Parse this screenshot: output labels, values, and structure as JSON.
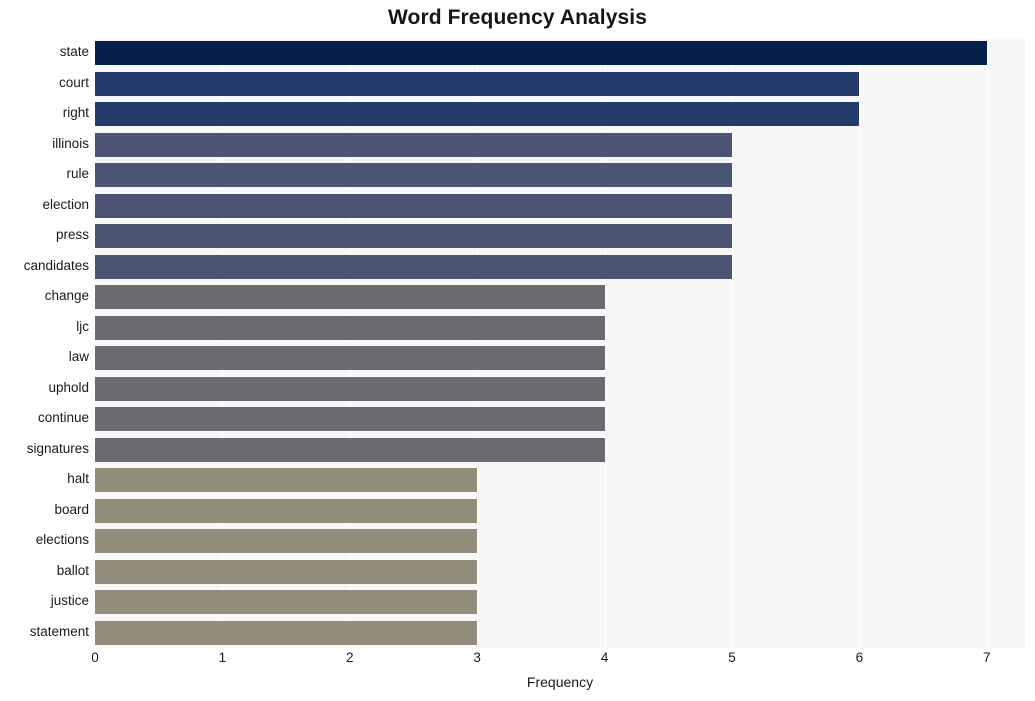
{
  "chart_data": {
    "type": "bar",
    "orientation": "horizontal",
    "title": "Word Frequency Analysis",
    "xlabel": "Frequency",
    "ylabel": "",
    "categories": [
      "state",
      "court",
      "right",
      "illinois",
      "rule",
      "election",
      "press",
      "candidates",
      "change",
      "ljc",
      "law",
      "uphold",
      "continue",
      "signatures",
      "halt",
      "board",
      "elections",
      "ballot",
      "justice",
      "statement"
    ],
    "values": [
      7,
      6,
      6,
      5,
      5,
      5,
      5,
      5,
      4,
      4,
      4,
      4,
      4,
      4,
      3,
      3,
      3,
      3,
      3,
      3
    ],
    "xlim": [
      0,
      7.3
    ],
    "xticks": [
      0,
      1,
      2,
      3,
      4,
      5,
      6,
      7
    ],
    "xtick_labels": [
      "0",
      "1",
      "2",
      "3",
      "4",
      "5",
      "6",
      "7"
    ],
    "grid": true,
    "grid_axis": "x",
    "legend": false,
    "bar_colors": [
      "#07204a",
      "#253b6c",
      "#253b6c",
      "#4b5472",
      "#4b5472",
      "#4b5472",
      "#4b5472",
      "#4b5472",
      "#696b70",
      "#696b70",
      "#696b70",
      "#696b70",
      "#696b70",
      "#696b70",
      "#938d7c",
      "#938d7c",
      "#938d7c",
      "#938d7c",
      "#938d7c",
      "#938d7c"
    ],
    "plot_background": "#f7f7f8",
    "figure_background": "#ffffff"
  }
}
